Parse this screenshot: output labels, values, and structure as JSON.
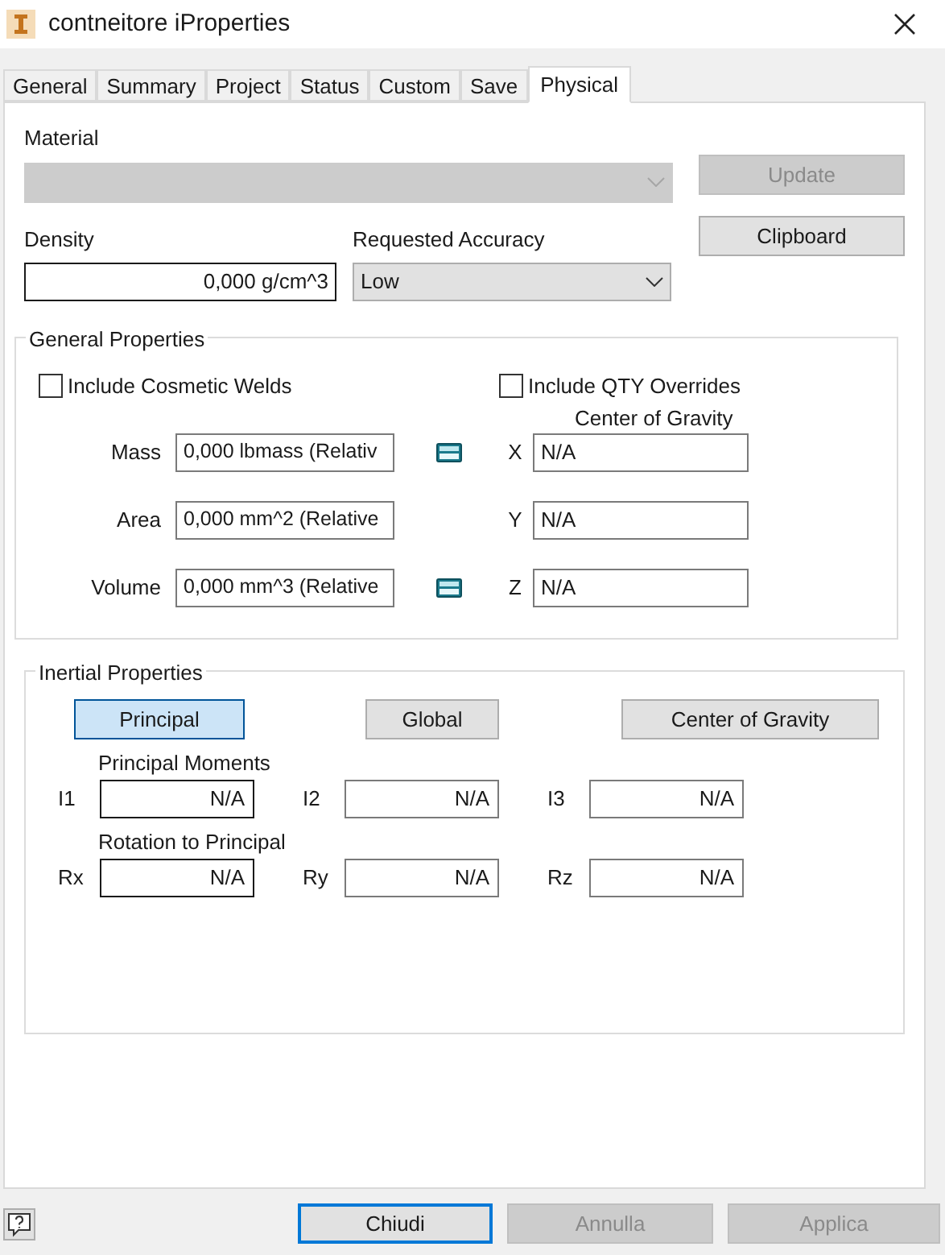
{
  "window": {
    "title": "contneitore iProperties"
  },
  "tabs": [
    {
      "label": "General",
      "selected": false
    },
    {
      "label": "Summary",
      "selected": false
    },
    {
      "label": "Project",
      "selected": false
    },
    {
      "label": "Status",
      "selected": false
    },
    {
      "label": "Custom",
      "selected": false
    },
    {
      "label": "Save",
      "selected": false
    },
    {
      "label": "Physical",
      "selected": true
    }
  ],
  "material": {
    "label": "Material",
    "disabled": true
  },
  "update_button": {
    "label": "Update",
    "disabled": true
  },
  "clipboard_button": {
    "label": "Clipboard",
    "disabled": false
  },
  "density": {
    "label": "Density",
    "value": "0,000 g/cm^3"
  },
  "accuracy": {
    "label": "Requested Accuracy",
    "value": "Low"
  },
  "general_properties": {
    "title": "General Properties",
    "checkboxes": [
      {
        "label": "Include Cosmetic Welds",
        "checked": false
      },
      {
        "label": "Include QTY Overrides",
        "checked": false
      }
    ],
    "center_of_gravity_label": "Center of Gravity",
    "rows": [
      {
        "label": "Mass",
        "value": "0,000 lbmass (Relativ",
        "calculator": true,
        "axis": "X",
        "axis_value": "N/A"
      },
      {
        "label": "Area",
        "value": "0,000 mm^2 (Relative",
        "calculator": false,
        "axis": "Y",
        "axis_value": "N/A"
      },
      {
        "label": "Volume",
        "value": "0,000 mm^3 (Relative",
        "calculator": true,
        "axis": "Z",
        "axis_value": "N/A"
      }
    ]
  },
  "inertial_properties": {
    "title": "Inertial Properties",
    "modes": [
      {
        "label": "Principal",
        "selected": true
      },
      {
        "label": "Global",
        "selected": false
      },
      {
        "label": "Center of Gravity",
        "selected": false
      }
    ],
    "groups": [
      {
        "title": "Principal Moments",
        "fields": [
          {
            "label": "I1",
            "value": "N/A"
          },
          {
            "label": "I2",
            "value": "N/A"
          },
          {
            "label": "I3",
            "value": "N/A"
          }
        ]
      },
      {
        "title": "Rotation to Principal",
        "fields": [
          {
            "label": "Rx",
            "value": "N/A"
          },
          {
            "label": "Ry",
            "value": "N/A"
          },
          {
            "label": "Rz",
            "value": "N/A"
          }
        ]
      }
    ]
  },
  "footer_buttons": [
    {
      "label": "Chiudi",
      "disabled": false,
      "default": true
    },
    {
      "label": "Annulla",
      "disabled": true,
      "default": false
    },
    {
      "label": "Applica",
      "disabled": true,
      "default": false
    }
  ]
}
